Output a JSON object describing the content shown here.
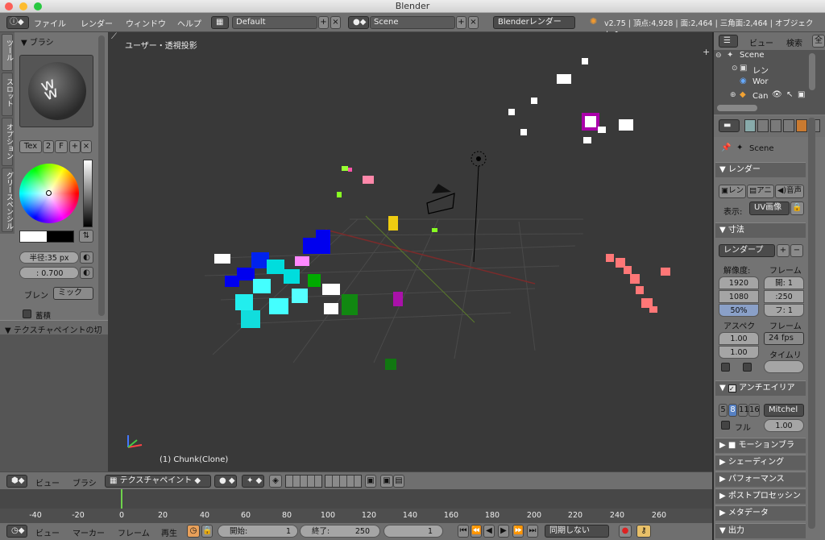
{
  "window": {
    "title": "Blender"
  },
  "menu": {
    "items": [
      "ファイル",
      "レンダー",
      "ウィンドウ",
      "ヘルプ"
    ],
    "layout": "Default",
    "scene": "Scene",
    "engine": "Blenderレンダー",
    "stats": "v2.75 | 頂点:4,928 | 面:2,464 | 三角面:2,464 | オブジェクト:1"
  },
  "tool_tabs": [
    "ツール",
    "スロット",
    "オプション",
    "グリースペンシル"
  ],
  "brush": {
    "section": "▼ ブラシ",
    "tex": "Tex",
    "users": "2",
    "fake": "F",
    "radius": "半径:35 px",
    "strength": ": 0.700",
    "blend_label": "ブレン",
    "blend_value": "ミック",
    "accumulate": "蓄積",
    "texpaint_label": "▼ テクスチャペイントの切"
  },
  "viewport": {
    "title": "ユーザー・透視投影",
    "object": "(1) Chunk(Clone)"
  },
  "outliner": {
    "view": "ビュー",
    "search": "検索",
    "all": "全",
    "items": [
      "Scene",
      "レン",
      "Wor",
      "Can"
    ]
  },
  "props": {
    "scene": "Scene",
    "render_section": "▼ レンダー",
    "render_btn": "レン",
    "anim_btn": "アニ",
    "audio_btn": "音声",
    "display_label": "表示:",
    "display_value": "UV画像",
    "dims_section": "▼ 寸法",
    "preset": "レンダープ",
    "res_label": "解像度:",
    "frame_label": "フレーム",
    "res_x": "1920",
    "res_y": "1080",
    "res_pct": "50%",
    "frame_start": "開: 1",
    "frame_end": ":250",
    "frame_step": "フ: 1",
    "aspect_label": "アスペク",
    "aspect_x": "1.00",
    "aspect_y": "1.00",
    "rate_label": "フレーム",
    "fps": "24 fps",
    "time_label": "タイムリ",
    "aa_label": "アンチエイリア",
    "aa_samples": [
      "5",
      "8",
      "11",
      "16"
    ],
    "aa_filter": "Mitchel",
    "full_label": "フル",
    "full_value": "1.00",
    "collapsed": [
      "▶ ■ モーションブラ",
      "▶ シェーディング",
      "▶ パフォーマンス",
      "▶ ポストプロセッシン",
      "▶ メタデータ",
      "▼ 出力"
    ]
  },
  "header3d": {
    "view": "ビュー",
    "brush": "ブラシ",
    "mode": "テクスチャペイント"
  },
  "timeline": {
    "ticks": [
      "-40",
      "-20",
      "0",
      "20",
      "40",
      "60",
      "80",
      "100",
      "120",
      "140",
      "160",
      "180",
      "200",
      "220",
      "240",
      "260"
    ]
  },
  "timeline_header": {
    "view": "ビュー",
    "marker": "マーカー",
    "frame": "フレーム",
    "playback": "再生",
    "start": "開始:",
    "start_val": "1",
    "end": "終了:",
    "end_val": "250",
    "current": "1",
    "sync": "同期しない"
  }
}
